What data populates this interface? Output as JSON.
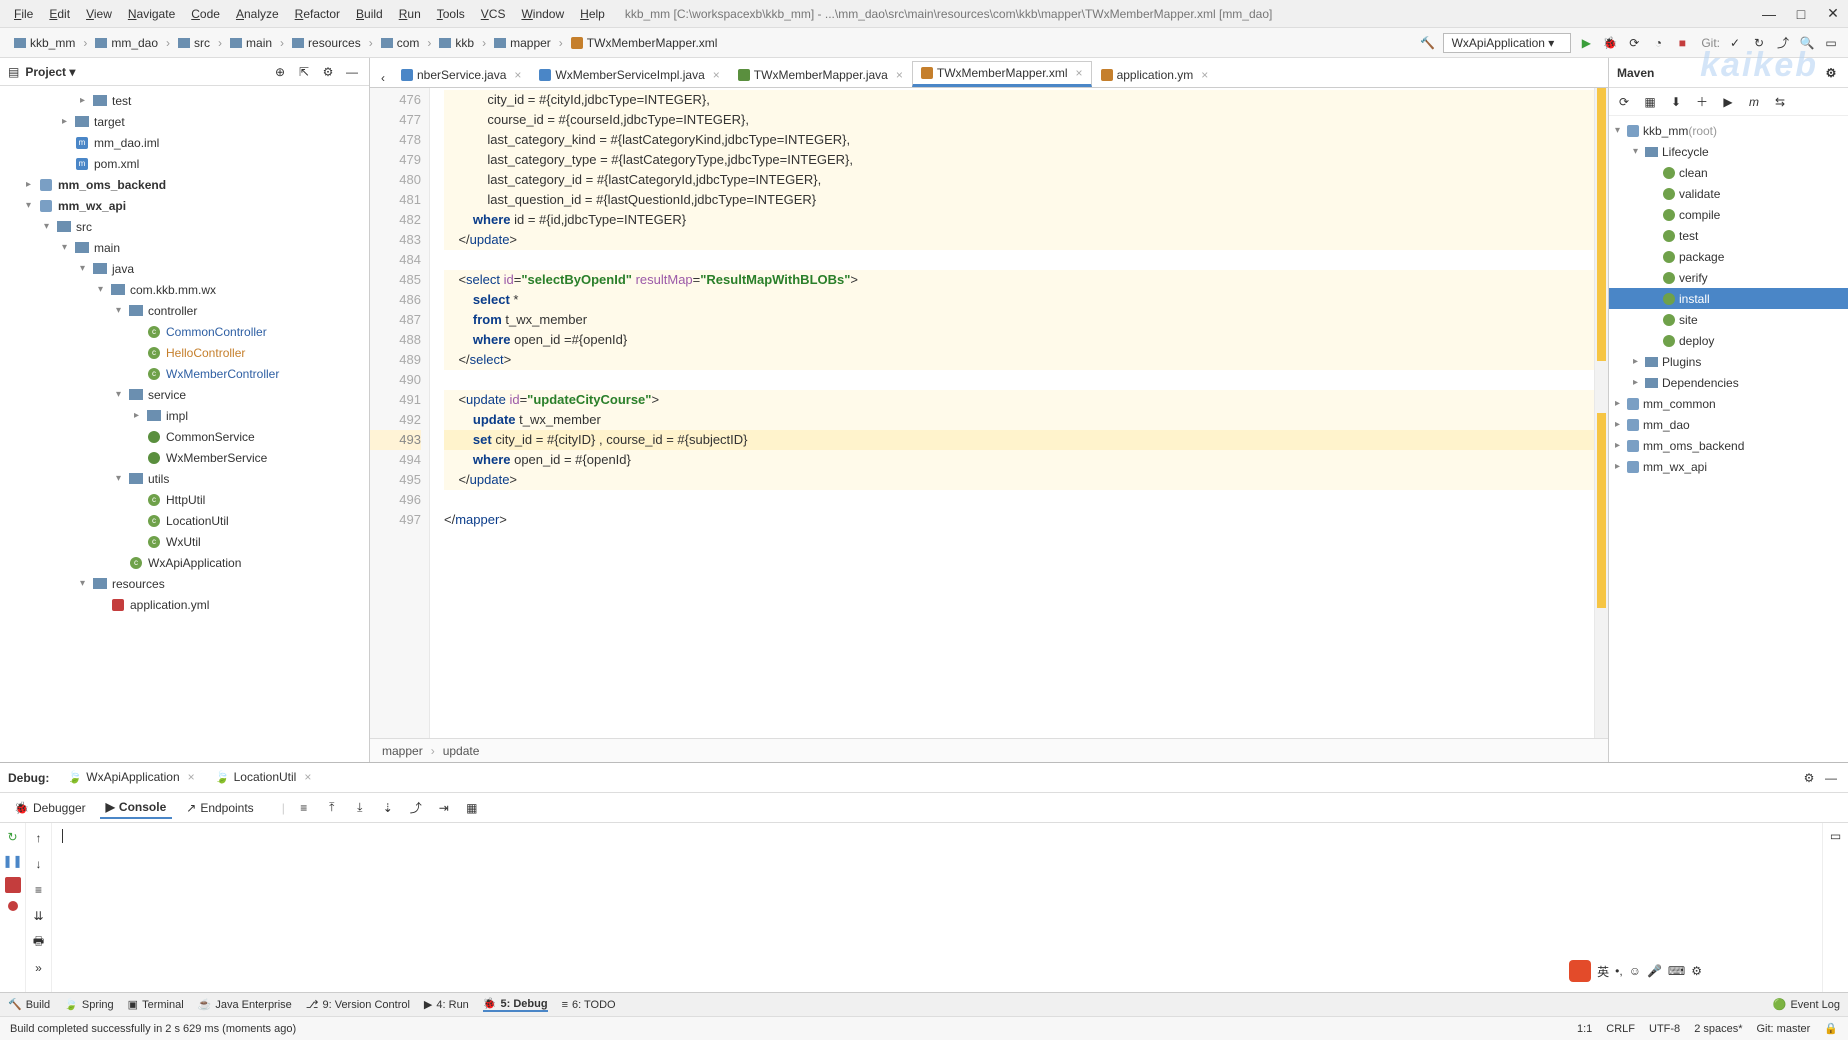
{
  "window": {
    "title_path": "kkb_mm [C:\\workspacexb\\kkb_mm] - ...\\mm_dao\\src\\main\\resources\\com\\kkb\\mapper\\TWxMemberMapper.xml [mm_dao]",
    "watermark": "kaikeb"
  },
  "menu": [
    "File",
    "Edit",
    "View",
    "Navigate",
    "Code",
    "Analyze",
    "Refactor",
    "Build",
    "Run",
    "Tools",
    "VCS",
    "Window",
    "Help"
  ],
  "breadcrumbs": [
    {
      "label": "kkb_mm",
      "kind": "module"
    },
    {
      "label": "mm_dao",
      "kind": "module"
    },
    {
      "label": "src",
      "kind": "folder"
    },
    {
      "label": "main",
      "kind": "folder"
    },
    {
      "label": "resources",
      "kind": "folder"
    },
    {
      "label": "com",
      "kind": "folder"
    },
    {
      "label": "kkb",
      "kind": "folder"
    },
    {
      "label": "mapper",
      "kind": "folder"
    },
    {
      "label": "TWxMemberMapper.xml",
      "kind": "xml"
    }
  ],
  "run_config": "WxApiApplication",
  "git_label": "Git:",
  "project": {
    "title": "Project",
    "tree": [
      {
        "indent": 4,
        "exp": ">",
        "icon": "folder",
        "label": "test"
      },
      {
        "indent": 3,
        "exp": ">",
        "icon": "folder",
        "label": "target"
      },
      {
        "indent": 3,
        "exp": "",
        "icon": "m",
        "label": "mm_dao.iml"
      },
      {
        "indent": 3,
        "exp": "",
        "icon": "m",
        "label": "pom.xml"
      },
      {
        "indent": 1,
        "exp": ">",
        "icon": "module",
        "label": "mm_oms_backend",
        "bold": true
      },
      {
        "indent": 1,
        "exp": "v",
        "icon": "module",
        "label": "mm_wx_api",
        "bold": true
      },
      {
        "indent": 2,
        "exp": "v",
        "icon": "folder",
        "label": "src"
      },
      {
        "indent": 3,
        "exp": "v",
        "icon": "folder",
        "label": "main"
      },
      {
        "indent": 4,
        "exp": "v",
        "icon": "folder",
        "label": "java"
      },
      {
        "indent": 5,
        "exp": "v",
        "icon": "folder",
        "label": "com.kkb.mm.wx"
      },
      {
        "indent": 6,
        "exp": "v",
        "icon": "folder",
        "label": "controller"
      },
      {
        "indent": 7,
        "exp": "",
        "icon": "c",
        "label": "CommonController",
        "class": "ico-class-blue"
      },
      {
        "indent": 7,
        "exp": "",
        "icon": "c",
        "label": "HelloController",
        "class": "ico-class-orange"
      },
      {
        "indent": 7,
        "exp": "",
        "icon": "c",
        "label": "WxMemberController",
        "class": "ico-class-blue"
      },
      {
        "indent": 6,
        "exp": "v",
        "icon": "folder",
        "label": "service"
      },
      {
        "indent": 7,
        "exp": ">",
        "icon": "folder",
        "label": "impl"
      },
      {
        "indent": 7,
        "exp": "",
        "icon": "i",
        "label": "CommonService"
      },
      {
        "indent": 7,
        "exp": "",
        "icon": "i",
        "label": "WxMemberService"
      },
      {
        "indent": 6,
        "exp": "v",
        "icon": "folder",
        "label": "utils"
      },
      {
        "indent": 7,
        "exp": "",
        "icon": "c",
        "label": "HttpUtil"
      },
      {
        "indent": 7,
        "exp": "",
        "icon": "c",
        "label": "LocationUtil"
      },
      {
        "indent": 7,
        "exp": "",
        "icon": "c",
        "label": "WxUtil"
      },
      {
        "indent": 6,
        "exp": "",
        "icon": "c",
        "label": "WxApiApplication"
      },
      {
        "indent": 4,
        "exp": "v",
        "icon": "folder",
        "label": "resources"
      },
      {
        "indent": 5,
        "exp": "",
        "icon": "yml",
        "label": "application.yml"
      }
    ]
  },
  "editor_tabs": [
    {
      "label": "nberService.java",
      "icon": "java",
      "active": false
    },
    {
      "label": "WxMemberServiceImpl.java",
      "icon": "java",
      "active": false
    },
    {
      "label": "TWxMemberMapper.java",
      "icon": "iface",
      "active": false
    },
    {
      "label": "TWxMemberMapper.xml",
      "icon": "xml",
      "active": true
    },
    {
      "label": "application.ym",
      "icon": "xml",
      "active": false
    }
  ],
  "gutter": [
    "476",
    "477",
    "478",
    "479",
    "480",
    "481",
    "482",
    "483",
    "484",
    "485",
    "486",
    "487",
    "488",
    "489",
    "490",
    "491",
    "492",
    "493",
    "494",
    "495",
    "496",
    "497"
  ],
  "current_line": "493",
  "code_lines": [
    {
      "hl": true,
      "html": "            city_id = #{cityId,jdbcType=INTEGER},"
    },
    {
      "hl": true,
      "html": "            course_id = #{courseId,jdbcType=INTEGER},"
    },
    {
      "hl": true,
      "html": "            last_category_kind = #{lastCategoryKind,jdbcType=INTEGER},"
    },
    {
      "hl": true,
      "html": "            last_category_type = #{lastCategoryType,jdbcType=INTEGER},"
    },
    {
      "hl": true,
      "html": "            last_category_id = #{lastCategoryId,jdbcType=INTEGER},"
    },
    {
      "hl": true,
      "html": "            last_question_id = #{lastQuestionId,jdbcType=INTEGER}"
    },
    {
      "hl": true,
      "html": "        <span class='kw'>where</span> id = #{id,jdbcType=INTEGER}"
    },
    {
      "hl": true,
      "html": "    &lt;/<span class='tag'>update</span>&gt;"
    },
    {
      "hl": false,
      "html": ""
    },
    {
      "hl": true,
      "html": "    &lt;<span class='tag'>select</span> <span class='attr'>id</span>=<span class='str'>\"selectByOpenId\"</span> <span class='attr'>resultMap</span>=<span class='str'>\"ResultMapWithBLOBs\"</span>&gt;"
    },
    {
      "hl": true,
      "html": "        <span class='kw'>select</span> *"
    },
    {
      "hl": true,
      "html": "        <span class='kw'>from</span> t_wx_member"
    },
    {
      "hl": true,
      "html": "        <span class='kw'>where</span> open_id =#{openId}"
    },
    {
      "hl": true,
      "html": "    &lt;/<span class='tag'>select</span>&gt;"
    },
    {
      "hl": false,
      "html": ""
    },
    {
      "hl": true,
      "html": "    &lt;<span class='tag'>update</span> <span class='attr'>id</span>=<span class='str'>\"updateCityCourse\"</span>&gt;"
    },
    {
      "hl": true,
      "html": "        <span class='kw'>update</span> t_wx_member"
    },
    {
      "hl": true,
      "cur": true,
      "html": "        <span class='kw'>set</span> city_id = #{cityID} , course_id = #{subjectID}"
    },
    {
      "hl": true,
      "html": "        <span class='kw'>where</span> open_id = #{openId}"
    },
    {
      "hl": true,
      "html": "    &lt;/<span class='tag'>update</span>&gt;"
    },
    {
      "hl": false,
      "html": ""
    },
    {
      "hl": false,
      "html": "&lt;/<span class='tag'>mapper</span>&gt;"
    }
  ],
  "editor_breadcrumb": [
    "mapper",
    "update"
  ],
  "maven": {
    "title": "Maven",
    "tree": [
      {
        "indent": 0,
        "exp": "v",
        "icon": "mod",
        "label": "kkb_mm",
        "suffix": "(root)"
      },
      {
        "indent": 1,
        "exp": "v",
        "icon": "folder",
        "label": "Lifecycle"
      },
      {
        "indent": 2,
        "exp": "",
        "icon": "gear",
        "label": "clean"
      },
      {
        "indent": 2,
        "exp": "",
        "icon": "gear",
        "label": "validate"
      },
      {
        "indent": 2,
        "exp": "",
        "icon": "gear",
        "label": "compile"
      },
      {
        "indent": 2,
        "exp": "",
        "icon": "gear",
        "label": "test"
      },
      {
        "indent": 2,
        "exp": "",
        "icon": "gear",
        "label": "package"
      },
      {
        "indent": 2,
        "exp": "",
        "icon": "gear",
        "label": "verify"
      },
      {
        "indent": 2,
        "exp": "",
        "icon": "gear",
        "label": "install",
        "selected": true
      },
      {
        "indent": 2,
        "exp": "",
        "icon": "gear",
        "label": "site"
      },
      {
        "indent": 2,
        "exp": "",
        "icon": "gear",
        "label": "deploy"
      },
      {
        "indent": 1,
        "exp": ">",
        "icon": "folder",
        "label": "Plugins"
      },
      {
        "indent": 1,
        "exp": ">",
        "icon": "folder",
        "label": "Dependencies"
      },
      {
        "indent": 0,
        "exp": ">",
        "icon": "mod",
        "label": "mm_common"
      },
      {
        "indent": 0,
        "exp": ">",
        "icon": "mod",
        "label": "mm_dao"
      },
      {
        "indent": 0,
        "exp": ">",
        "icon": "mod",
        "label": "mm_oms_backend"
      },
      {
        "indent": 0,
        "exp": ">",
        "icon": "mod",
        "label": "mm_wx_api"
      }
    ]
  },
  "debug": {
    "label": "Debug:",
    "tabs": [
      {
        "label": "WxApiApplication",
        "active": true
      },
      {
        "label": "LocationUtil",
        "active": false
      }
    ],
    "subtabs": [
      {
        "label": "Debugger",
        "icon": "🐞"
      },
      {
        "label": "Console",
        "icon": "▶",
        "active": true
      },
      {
        "label": "Endpoints",
        "icon": "↗"
      }
    ]
  },
  "bottom_tabs": [
    {
      "label": "Build",
      "icon": "🔨"
    },
    {
      "label": "Spring",
      "icon": "🍃"
    },
    {
      "label": "Terminal",
      "icon": "▣"
    },
    {
      "label": "Java Enterprise",
      "icon": "☕"
    },
    {
      "label": "9: Version Control",
      "icon": "⎇"
    },
    {
      "label": "4: Run",
      "icon": "▶"
    },
    {
      "label": "5: Debug",
      "icon": "🐞",
      "active": true
    },
    {
      "label": "6: TODO",
      "icon": "≡"
    }
  ],
  "event_log": "Event Log",
  "status": {
    "message": "Build completed successfully in 2 s 629 ms (moments ago)",
    "pos": "1:1",
    "eol": "CRLF",
    "enc": "UTF-8",
    "indent": "2 spaces*",
    "git": "Git: master"
  }
}
